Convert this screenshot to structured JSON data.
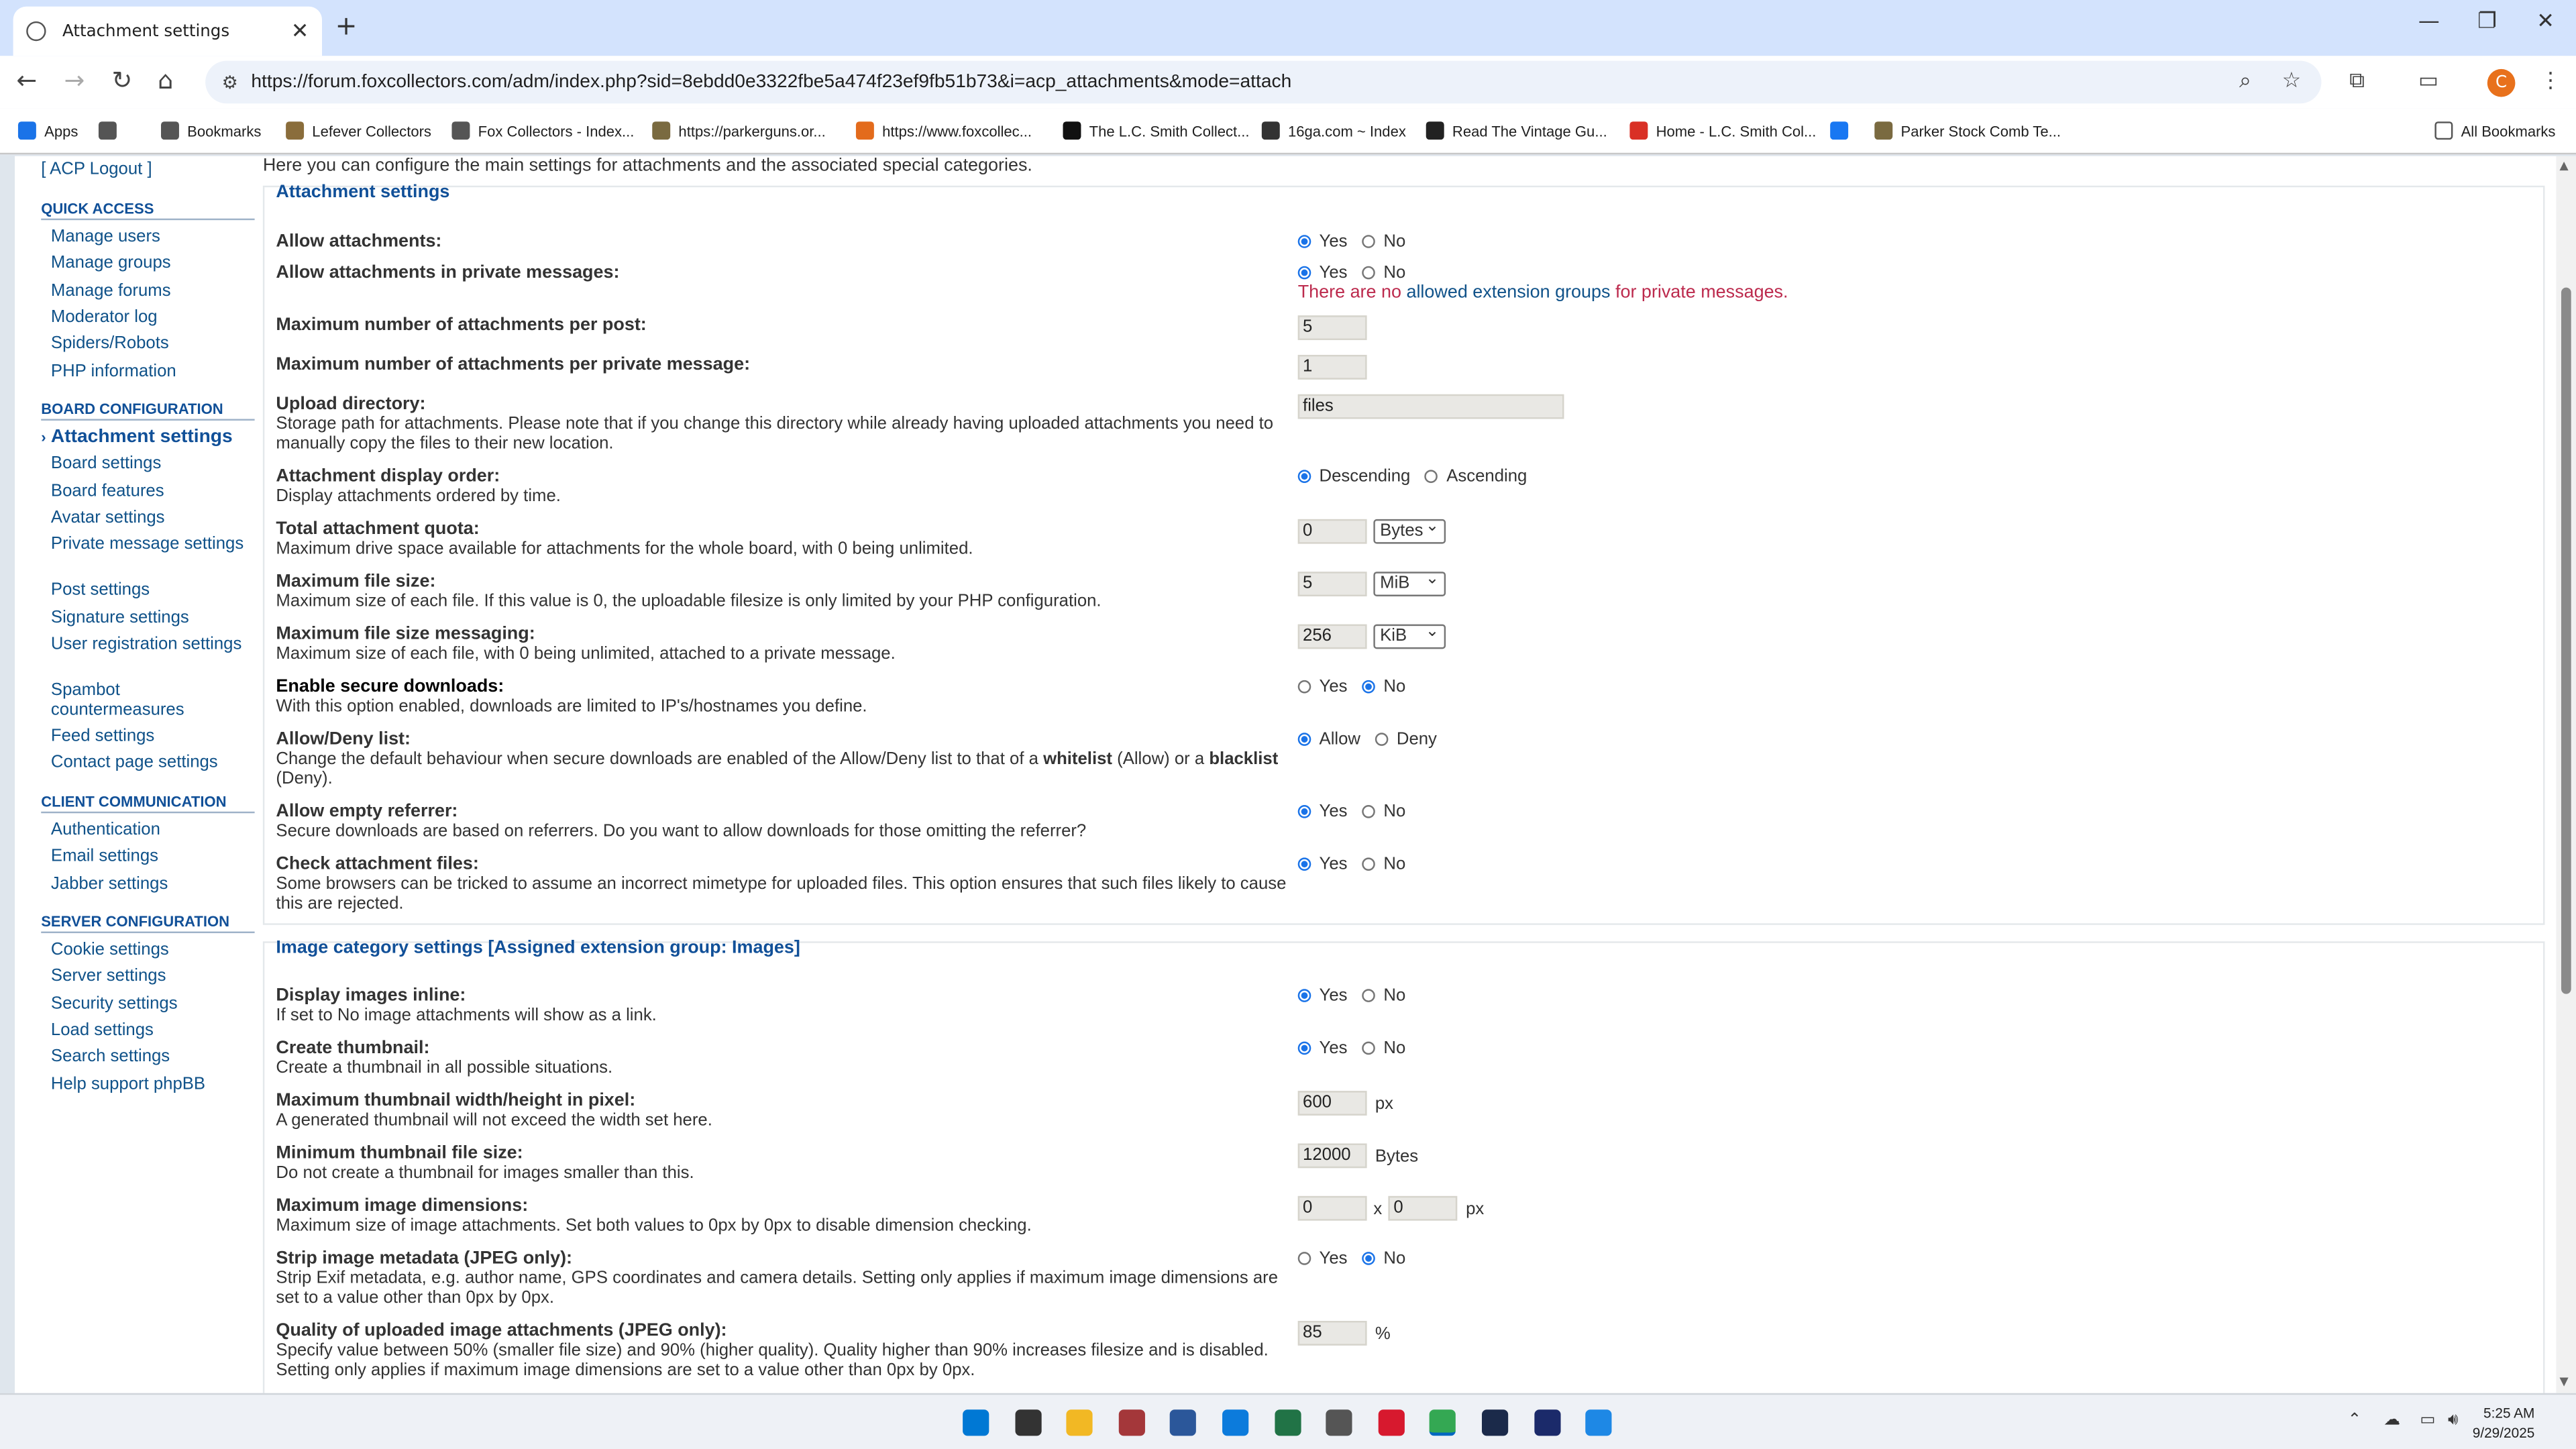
{
  "browser": {
    "tab_title": "Attachment settings",
    "url": "https://forum.foxcollectors.com/adm/index.php?sid=8ebdd0e3322fbe5a474f23ef9fb51b73&i=acp_attachments&mode=attach",
    "avatar_letter": "C",
    "bookmarks": [
      {
        "label": "Apps",
        "icon": "apps-grid-icon",
        "color": "#1a73e8"
      },
      {
        "label": "",
        "icon": "tab-groups-icon",
        "color": "#555555"
      },
      {
        "label": "Bookmarks",
        "icon": "folder-icon",
        "color": "#555555"
      },
      {
        "label": "Lefever Collectors",
        "icon": "site-favicon",
        "color": "#8a6d3b"
      },
      {
        "label": "Fox Collectors - Index...",
        "icon": "site-favicon",
        "color": "#555555"
      },
      {
        "label": "https://parkerguns.or...",
        "icon": "site-favicon",
        "color": "#7a6a40"
      },
      {
        "label": "https://www.foxcollec...",
        "icon": "site-favicon",
        "color": "#e36b1c"
      },
      {
        "label": "The L.C. Smith Collect...",
        "icon": "site-favicon",
        "color": "#111111"
      },
      {
        "label": "16ga.com ~ Index",
        "icon": "site-favicon",
        "color": "#333333"
      },
      {
        "label": "Read The Vintage Gu...",
        "icon": "site-favicon",
        "color": "#222222"
      },
      {
        "label": "Home - L.C. Smith Col...",
        "icon": "site-favicon",
        "color": "#d93025"
      },
      {
        "label": "",
        "icon": "facebook-icon",
        "color": "#1877f2"
      },
      {
        "label": "Parker Stock Comb Te...",
        "icon": "site-favicon",
        "color": "#7a6a40"
      }
    ],
    "all_bookmarks": "All Bookmarks"
  },
  "sidebar": {
    "logout": "[ ACP Logout ]",
    "sections": [
      {
        "title": "QUICK ACCESS",
        "items": [
          "Manage users",
          "Manage groups",
          "Manage forums",
          "Moderator log",
          "Spiders/Robots",
          "PHP information"
        ]
      },
      {
        "title": "BOARD CONFIGURATION",
        "items": [
          "Attachment settings",
          "Board settings",
          "Board features",
          "Avatar settings",
          "Private message settings",
          "Post settings",
          "Signature settings",
          "User registration settings",
          "Spambot countermeasures",
          "Feed settings",
          "Contact page settings"
        ]
      },
      {
        "title": "CLIENT COMMUNICATION",
        "items": [
          "Authentication",
          "Email settings",
          "Jabber settings"
        ]
      },
      {
        "title": "SERVER CONFIGURATION",
        "items": [
          "Cookie settings",
          "Server settings",
          "Security settings",
          "Load settings",
          "Search settings",
          "Help support phpBB"
        ]
      }
    ]
  },
  "main": {
    "intro": "Here you can configure the main settings for attachments and the associated special categories.",
    "attachment": {
      "legend": "Attachment settings",
      "allow_attachments": {
        "title": "Allow attachments:",
        "yes": "Yes",
        "no": "No"
      },
      "allow_pm": {
        "title": "Allow attachments in private messages:",
        "yes": "Yes",
        "no": "No"
      },
      "pm_error": {
        "before": "There are no",
        "link": "allowed extension groups",
        "after": "for private messages."
      },
      "max_per_post": {
        "title": "Maximum number of attachments per post:",
        "value": "5"
      },
      "max_per_pm": {
        "title": "Maximum number of attachments per private message:",
        "value": "1"
      },
      "upload_dir": {
        "title": "Upload directory:",
        "desc": "Storage path for attachments. Please note that if you change this directory while already having uploaded attachments you need to manually copy the files to their new location.",
        "value": "files"
      },
      "display_order": {
        "title": "Attachment display order:",
        "desc": "Display attachments ordered by time.",
        "opt1": "Descending",
        "opt2": "Ascending"
      },
      "quota": {
        "title": "Total attachment quota:",
        "desc": "Maximum drive space available for attachments for the whole board, with 0 being unlimited.",
        "value": "0",
        "unit": "Bytes"
      },
      "max_filesize": {
        "title": "Maximum file size:",
        "desc": "Maximum size of each file. If this value is 0, the uploadable filesize is only limited by your PHP configuration.",
        "value": "5",
        "unit": "MiB"
      },
      "max_filesize_pm": {
        "title": "Maximum file size messaging:",
        "desc": "Maximum size of each file, with 0 being unlimited, attached to a private message.",
        "value": "256",
        "unit": "KiB"
      },
      "secure_downloads": {
        "title": "Enable secure downloads:",
        "desc": "With this option enabled, downloads are limited to IP's/hostnames you define.",
        "yes": "Yes",
        "no": "No"
      },
      "allow_deny": {
        "title": "Allow/Deny list:",
        "desc_1": "Change the default behaviour when secure downloads are enabled of the Allow/Deny list to that of a",
        "whitelist": "whitelist",
        "desc_2": "(Allow) or a",
        "blacklist": "blacklist",
        "desc_3": "(Deny).",
        "opt1": "Allow",
        "opt2": "Deny"
      },
      "empty_referrer": {
        "title": "Allow empty referrer:",
        "desc": "Secure downloads are based on referrers. Do you want to allow downloads for those omitting the referrer?",
        "yes": "Yes",
        "no": "No"
      },
      "check_files": {
        "title": "Check attachment files:",
        "desc": "Some browsers can be tricked to assume an incorrect mimetype for uploaded files. This option ensures that such files likely to cause this are rejected.",
        "yes": "Yes",
        "no": "No"
      }
    },
    "image": {
      "legend": "Image category settings [Assigned extension group: Images]",
      "inline": {
        "title": "Display images inline:",
        "desc": "If set to No image attachments will show as a link.",
        "yes": "Yes",
        "no": "No"
      },
      "thumbnail": {
        "title": "Create thumbnail:",
        "desc": "Create a thumbnail in all possible situations.",
        "yes": "Yes",
        "no": "No"
      },
      "thumb_max": {
        "title": "Maximum thumbnail width/height in pixel:",
        "desc": "A generated thumbnail will not exceed the width set here.",
        "value": "600",
        "unit": "px"
      },
      "thumb_min_size": {
        "title": "Minimum thumbnail file size:",
        "desc": "Do not create a thumbnail for images smaller than this.",
        "value": "12000",
        "unit": "Bytes"
      },
      "max_dims": {
        "title": "Maximum image dimensions:",
        "desc": "Maximum size of image attachments. Set both values to 0px by 0px to disable dimension checking.",
        "w": "0",
        "sep": "x",
        "h": "0",
        "unit": "px"
      },
      "strip_meta": {
        "title": "Strip image metadata (JPEG only):",
        "desc": "Strip Exif metadata, e.g. author name, GPS coordinates and camera details. Setting only applies if maximum image dimensions are set to a value other than 0px by 0px.",
        "yes": "Yes",
        "no": "No"
      },
      "quality": {
        "title": "Quality of uploaded image attachments (JPEG only):",
        "desc": "Specify value between 50% (smaller file size) and 90% (higher quality). Quality higher than 90% increases filesize and is disabled. Setting only applies if maximum image dimensions are set to a value other than 0px by 0px.",
        "value": "85",
        "unit": "%"
      }
    }
  },
  "taskbar": {
    "time": "5:25 AM",
    "date": "9/29/2025",
    "apps": [
      {
        "name": "start-icon",
        "color": "#0078d4"
      },
      {
        "name": "file-explorer-dark-icon",
        "color": "#333333"
      },
      {
        "name": "folder-icon",
        "color": "#f2b824"
      },
      {
        "name": "access-icon",
        "color": "#a4373a"
      },
      {
        "name": "word-icon",
        "color": "#2b579a"
      },
      {
        "name": "edge-icon",
        "color": "#0c7bdc"
      },
      {
        "name": "excel-icon",
        "color": "#217346"
      },
      {
        "name": "calculator-icon",
        "color": "#555555"
      },
      {
        "name": "acrobat-icon",
        "color": "#d7192e"
      },
      {
        "name": "chrome-icon",
        "color": "#34a853"
      },
      {
        "name": "camera-app-icon",
        "color": "#1b2a4a"
      },
      {
        "name": "photo-app-icon",
        "color": "#1b2a6a"
      },
      {
        "name": "store-app-icon",
        "color": "#1e88e5"
      }
    ]
  }
}
